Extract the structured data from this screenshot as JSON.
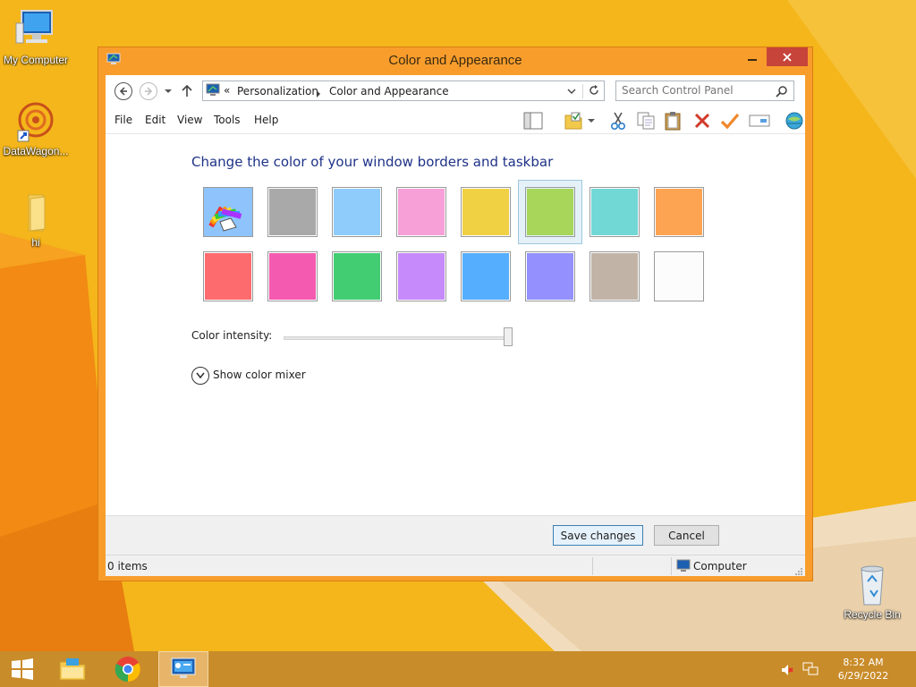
{
  "desktop": {
    "icons": [
      {
        "label": "My Computer"
      },
      {
        "label": "DataWagon..."
      },
      {
        "label": "hi"
      },
      {
        "label": "Recycle Bin"
      }
    ]
  },
  "window": {
    "title": "Color and Appearance",
    "nav": {
      "breadcrumb_sep": "«",
      "breadcrumb_1": "Personalization",
      "breadcrumb_2": "Color and Appearance",
      "search_placeholder": "Search Control Panel"
    },
    "menu": {
      "file": "File",
      "edit": "Edit",
      "view": "View",
      "tools": "Tools",
      "help": "Help"
    },
    "content": {
      "heading": "Change the color of your window borders and taskbar",
      "swatches_row1": [
        "#a9a9a9",
        "#8fccfb",
        "#f6a0d7",
        "#f0d144",
        "#a7d65a",
        "#71d8d6",
        "#fca452"
      ],
      "swatches_row2": [
        "#fe6b6f",
        "#f45bb0",
        "#43cd72",
        "#c68afb",
        "#55aefe",
        "#9491ff",
        "#c1b4a7",
        "#fcfcfc"
      ],
      "selected_color": "#a7d65a",
      "intensity_label": "Color intensity:",
      "intensity_value": 1.0,
      "mixer_label": "Show color mixer"
    },
    "buttons": {
      "save": "Save changes",
      "cancel": "Cancel"
    },
    "status": {
      "items": "0 items",
      "location": "Computer"
    }
  },
  "taskbar": {
    "time": "8:32 AM",
    "date": "6/29/2022"
  },
  "colors": {
    "desktop": "#f4b61a",
    "window_frame": "#f89d2c",
    "heading": "#1e3287"
  }
}
